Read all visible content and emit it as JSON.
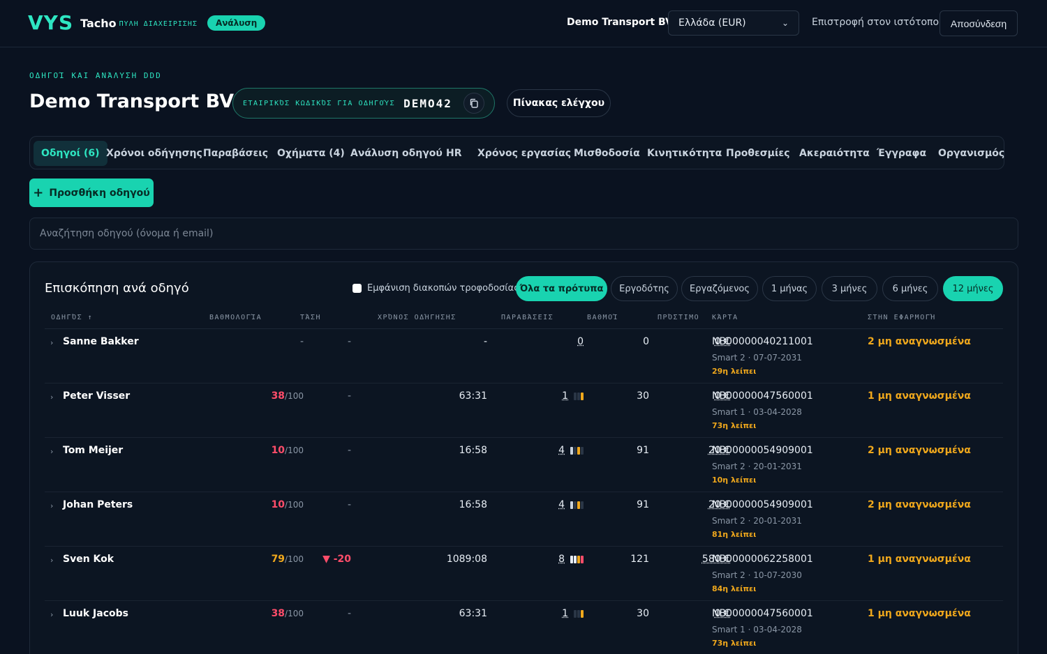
{
  "header": {
    "logo": "VYS",
    "brand": "Tacho",
    "brand_sub": "ΠΥΛΗ ΔΙΑΧΕΙΡΙΣΗΣ",
    "badge": "Ανάλυση",
    "company": "Demo Transport BV",
    "region": "Ελλάδα (EUR)",
    "back_link": "Επιστροφή στον ιστότοπο",
    "logout": "Αποσύνδεση"
  },
  "page": {
    "eyebrow": "ΟΔΗΓΟΊ ΚΑΙ ΑΝΆΛΥΣΗ DDD",
    "title": "Demo Transport BV",
    "code_label": "ΕΤΑΙΡΙΚΌΣ ΚΩΔΙΚΌΣ ΓΙΑ ΟΔΗΓΟΎΣ",
    "code_value": "DEMO42",
    "dashboard_button": "Πίνακας ελέγχου"
  },
  "tabs": [
    "Οδηγοί (6)",
    "Χρόνοι οδήγησης",
    "Παραβάσεις",
    "Οχήματα (4)",
    "Ανάλυση οδηγού",
    "HR",
    "Χρόνος εργασίας",
    "Μισθοδοσία",
    "Κινητικότητα",
    "Προθεσμίες",
    "Ακεραιότητα",
    "Έγγραφα",
    "Οργανισμός"
  ],
  "add_driver": "Προσθήκη οδηγού",
  "search_placeholder": "Αναζήτηση οδηγού (όνομα ή email)",
  "overview": {
    "title": "Επισκόπηση ανά οδηγό",
    "checkbox_label": "Εμφάνιση διακοπών τροφοδοσίας",
    "filters": [
      "Όλα τα πρότυπα",
      "Εργοδότης",
      "Εργαζόμενος",
      "1 μήνας",
      "3 μήνες",
      "6 μήνες",
      "12 μήνες"
    ],
    "columns": [
      "ΟΔΗΓΌΣ ↑",
      "ΒΑΘΜΟΛΟΓΊΑ",
      "ΤΆΣΗ",
      "ΧΡΌΝΟΣ ΟΔΉΓΗΣΗΣ",
      "ΠΑΡΑΒΆΣΕΙΣ",
      "ΒΑΘΜΟΊ",
      "ΠΡΌΣΤΙΜΟ",
      "ΚΆΡΤΑ",
      "ΣΤΗΝ ΕΦΑΡΜΟΓΉ"
    ],
    "rows": [
      {
        "name": "Sanne Bakker",
        "score": "-",
        "score_den": "",
        "trend": "-",
        "time": "-",
        "violations": "0",
        "points": "0",
        "fine": "0 €",
        "card": "NB00000040211001",
        "card_meta": "Smart 2 · 07-07-2031",
        "card_left": "29η λείπει",
        "unread": "2 μη αναγνωσμένα"
      },
      {
        "name": "Peter Visser",
        "score": "38",
        "score_den": "/100",
        "trend": "-",
        "time": "63:31",
        "violations": "1",
        "points": "30",
        "fine": "0 €",
        "card": "NB00000047560001",
        "card_meta": "Smart 1 · 03-04-2028",
        "card_left": "73η λείπει",
        "unread": "1 μη αναγνωσμένα"
      },
      {
        "name": "Tom Meijer",
        "score": "10",
        "score_den": "/100",
        "trend": "-",
        "time": "16:58",
        "violations": "4",
        "points": "91",
        "fine": "20 €",
        "card": "NB00000054909001",
        "card_meta": "Smart 2 · 20-01-2031",
        "card_left": "10η λείπει",
        "unread": "2 μη αναγνωσμένα"
      },
      {
        "name": "Johan Peters",
        "score": "10",
        "score_den": "/100",
        "trend": "-",
        "time": "16:58",
        "violations": "4",
        "points": "91",
        "fine": "20 €",
        "card": "NB00000054909001",
        "card_meta": "Smart 2 · 20-01-2031",
        "card_left": "81η λείπει",
        "unread": "2 μη αναγνωσμένα"
      },
      {
        "name": "Sven Kok",
        "score": "79",
        "score_den": "/100",
        "trend": "▼ -20",
        "time": "1089:08",
        "violations": "8",
        "points": "121",
        "fine": "580 €",
        "card": "NB00000062258001",
        "card_meta": "Smart 2 · 10-07-2030",
        "card_left": "84η λείπει",
        "unread": "1 μη αναγνωσμένα"
      },
      {
        "name": "Luuk Jacobs",
        "score": "38",
        "score_den": "/100",
        "trend": "-",
        "time": "63:31",
        "violations": "1",
        "points": "30",
        "fine": "0 €",
        "card": "NB00000047560001",
        "card_meta": "Smart 1 · 03-04-2028",
        "card_left": "73η λείπει",
        "unread": "1 μη αναγνωσμένα"
      }
    ]
  },
  "colors": {
    "accent": "#19d3b0",
    "danger": "#ff4d6a",
    "warning": "#f0a81c",
    "background": "#0a1220"
  }
}
